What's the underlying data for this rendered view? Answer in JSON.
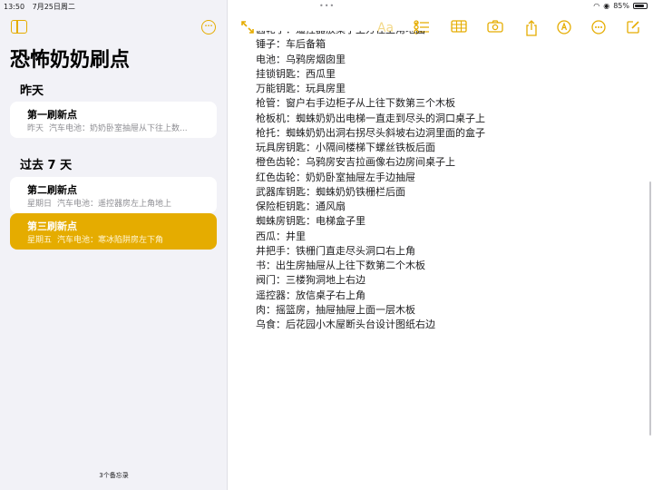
{
  "status": {
    "time": "13:50",
    "date": "7月25日周二",
    "battery_label": "85%",
    "battery_level": 0.85
  },
  "sidebar": {
    "folder_title": "恐怖奶奶刷点",
    "sections": [
      {
        "title": "昨天",
        "notes": [
          {
            "title": "第一刷新点",
            "date": "昨天",
            "preview": "汽车电池：奶奶卧室抽屉从下往上数...",
            "selected": false
          }
        ]
      },
      {
        "title": "过去 7 天",
        "notes": [
          {
            "title": "第二刷新点",
            "date": "星期日",
            "preview": "汽车电池：遥控器房左上角地上",
            "selected": false
          },
          {
            "title": "第三刷新点",
            "date": "星期五",
            "preview": "汽车电池：寒冰陷阱房左下角",
            "selected": true
          }
        ]
      }
    ],
    "note_count": "3个备忘录"
  },
  "toolbar": {
    "format_label": "Aa"
  },
  "note": {
    "lines": [
      "齿轮手：遥控器放桌子上方往上角地面",
      "锤子：车后备箱",
      "电池：乌鸦房烟囱里",
      "挂锁钥匙：西瓜里",
      "万能钥匙：玩具房里",
      "枪管：窗户右手边柜子从上往下数第三个木板",
      "枪板机：蜘蛛奶奶出电梯一直走到尽头的洞口桌子上",
      "枪托：蜘蛛奶奶出洞右拐尽头斜坡右边洞里面的盒子",
      "玩具房钥匙：小隔间楼梯下螺丝铁板后面",
      "橙色齿轮：乌鸦房安吉拉画像右边房间桌子上",
      "红色齿轮：奶奶卧室抽屉左手边抽屉",
      "武器库钥匙：蜘蛛奶奶铁栅栏后面",
      "保险柜钥匙：通风扇",
      "蜘蛛房钥匙：电梯盒子里",
      "西瓜：井里",
      "井把手：铁栅门直走尽头洞口右上角",
      "书：出生房抽屉从上往下数第二个木板",
      "阀门：三楼狗洞地上右边",
      "遥控器：放信桌子右上角",
      "肉：摇篮房，抽屉抽屉上面一层木板",
      "乌食：后花园小木屋断头台设计图纸右边"
    ]
  }
}
